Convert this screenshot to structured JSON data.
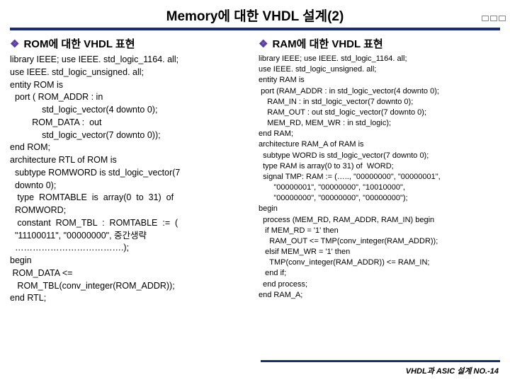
{
  "title": "Memory에 대한 VHDL 설계(2)",
  "left": {
    "heading": "ROM에 대한 VHDL 표현",
    "code": "library IEEE; use IEEE. std_logic_1164. all;\nuse IEEE. std_logic_unsigned. all;\nentity ROM is\n  port ( ROM_ADDR : in\n             std_logic_vector(4 downto 0);\n         ROM_DATA :  out\n             std_logic_vector(7 downto 0));\nend ROM;\narchitecture RTL of ROM is\n  subtype ROMWORD is std_logic_vector(7\n  downto 0);\n   type  ROMTABLE  is  array(0  to  31)  of\n  ROMWORD;\n   constant  ROM_TBL  :  ROMTABLE  :=  (\n  \"11100011\", \"00000000\", 중간생략\n  ……………………………….);\nbegin\n ROM_DATA <=\n   ROM_TBL(conv_integer(ROM_ADDR));\nend RTL;"
  },
  "right": {
    "heading": "RAM에 대한 VHDL 표현",
    "code": "library IEEE; use IEEE. std_logic_1164. all;\nuse IEEE. std_logic_unsigned. all;\nentity RAM is\n port (RAM_ADDR : in std_logic_vector(4 downto 0);\n    RAM_IN : in std_logic_vector(7 downto 0);\n    RAM_OUT : out std_logic_vector(7 downto 0);\n    MEM_RD, MEM_WR : in std_logic);\nend RAM;\narchitecture RAM_A of RAM is\n  subtype WORD is std_logic_vector(7 downto 0);\n  type RAM is array(0 to 31) of  WORD;\n  signal TMP: RAM := (….., \"00000000\", \"00000001\",\n       \"00000001\", \"00000000\", \"10010000\",\n       \"00000000\", \"00000000\", \"00000000\");\nbegin\n  process (MEM_RD, RAM_ADDR, RAM_IN) begin\n   if MEM_RD = '1' then\n     RAM_OUT <= TMP(conv_integer(RAM_ADDR));\n   elsif MEM_WR = '1' then\n     TMP(conv_integer(RAM_ADDR)) <= RAM_IN;\n   end if;\n  end process;\nend RAM_A;"
  },
  "footer": "VHDL과 ASIC 설계 NO.-14"
}
